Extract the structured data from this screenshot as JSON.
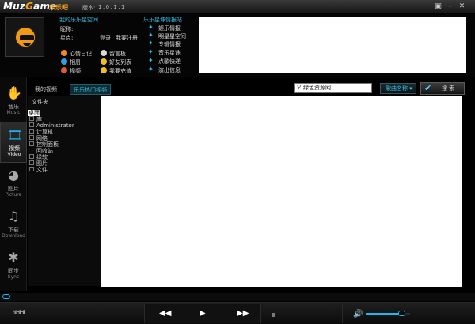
{
  "app": {
    "brand": {
      "a": "Muz",
      "o": "G",
      "b": "ame"
    },
    "brand_cn": "乐乐吧",
    "version_label": "版本:",
    "version_value": "1.0.1.1",
    "window_buttons": [
      "▣",
      "–",
      "✕"
    ]
  },
  "profile": {
    "section_title": "我的乐乐星空间",
    "nickname_label": "昵称:",
    "stars_label": "星点:",
    "login": "登录",
    "register": "我要注册",
    "links": [
      {
        "label": "心情日记",
        "icon": "heart-icon",
        "color": "#f08a24"
      },
      {
        "label": "留言板",
        "icon": "message-icon",
        "color": "#d8d8d8"
      },
      {
        "label": "相册",
        "icon": "photo-icon",
        "color": "#2e9fe0"
      },
      {
        "label": "好友列表",
        "icon": "friends-icon",
        "color": "#f0c020"
      },
      {
        "label": "视频",
        "icon": "video-icon",
        "color": "#e05a3a"
      },
      {
        "label": "我要充值",
        "icon": "coin-icon",
        "color": "#f0c020"
      }
    ]
  },
  "starnet": {
    "section_title": "乐乐星球情报站",
    "links": [
      "娱乐情报",
      "明星星空间",
      "专辑情报",
      "音乐星途",
      "点歌快递",
      "演出信息"
    ]
  },
  "nav": {
    "items": [
      {
        "cn": "音乐",
        "en": "Music",
        "icon": "hand-icon",
        "glyph": "✋",
        "active": false
      },
      {
        "cn": "视频",
        "en": "Video",
        "icon": "film-icon",
        "glyph": "🎞",
        "active": true
      },
      {
        "cn": "图片",
        "en": "Picture",
        "icon": "camera-icon",
        "glyph": "◕",
        "active": false
      },
      {
        "cn": "下载",
        "en": "Download",
        "icon": "download-icon",
        "glyph": "♫",
        "active": false
      },
      {
        "cn": "同步",
        "en": "Sync",
        "icon": "sync-icon",
        "glyph": "✱",
        "active": false
      }
    ]
  },
  "tabs": [
    {
      "label": "我的视频",
      "active": false
    },
    {
      "label": "乐乐热门视频",
      "active": true
    }
  ],
  "search": {
    "value": "绿色资源网",
    "sort_label": "歌曲名称 ▾",
    "button_label": "搜  索"
  },
  "folders": {
    "title": "文件夹",
    "root": "桌面",
    "items": [
      "库",
      "Administrator",
      "计算机",
      "网络",
      "控制面板",
      "回收站",
      "绿软",
      "图片",
      "文件"
    ]
  },
  "player": {
    "brand_mini": "hiHiHi",
    "prev": "◀◀",
    "play": "▶",
    "next": "▶▶",
    "volume_icon": "🔊",
    "volume_level": 0.82,
    "progress": 0
  }
}
